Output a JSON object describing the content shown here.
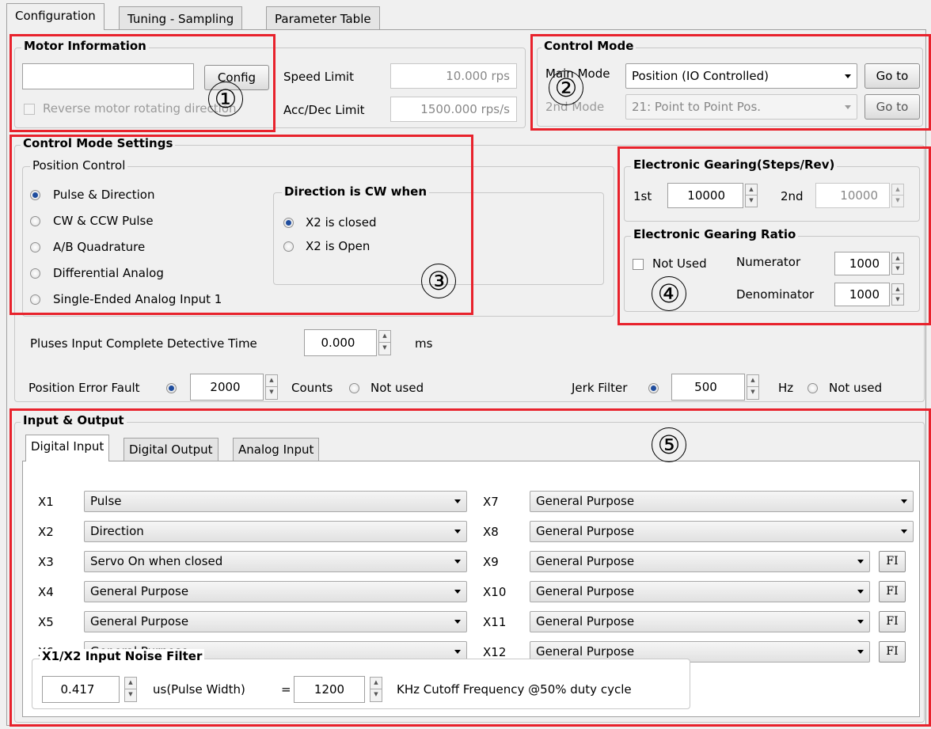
{
  "tabs": [
    "Configuration",
    "Tuning - Sampling",
    "Parameter Table"
  ],
  "annotations": [
    "①",
    "②",
    "③",
    "④",
    "⑤"
  ],
  "motor": {
    "title": "Motor Information",
    "name_value": "",
    "config_label": "Config",
    "reverse_label": "Reverse motor rotating direction",
    "speed_limit_label": "Speed Limit",
    "speed_limit_value": "10.000 rps",
    "accdec_label": "Acc/Dec Limit",
    "accdec_value": "1500.000 rps/s"
  },
  "control_mode": {
    "title": "Control Mode",
    "main_label": "Main Mode",
    "main_value": "Position (IO Controlled)",
    "second_label": "2nd Mode",
    "second_value": "21: Point to Point Pos.",
    "goto_label": "Go to"
  },
  "settings": {
    "title": "Control Mode Settings",
    "position_title": "Position Control",
    "options": [
      "Pulse & Direction",
      "CW & CCW Pulse",
      "A/B Quadrature",
      "Differential Analog",
      "Single-Ended Analog Input 1"
    ],
    "selected_index": 0,
    "direction_title": "Direction is CW when",
    "direction_options": [
      "X2 is closed",
      "X2 is Open"
    ],
    "direction_selected": 0
  },
  "gearing": {
    "steps_title": "Electronic Gearing(Steps/Rev)",
    "first_label": "1st",
    "first_value": "10000",
    "second_label": "2nd",
    "second_value": "10000",
    "ratio_title": "Electronic Gearing Ratio",
    "not_used_label": "Not Used",
    "numerator_label": "Numerator",
    "numerator_value": "1000",
    "denominator_label": "Denominator",
    "denominator_value": "1000"
  },
  "misc": {
    "pulses_label": "Pluses Input Complete Detective Time",
    "pulses_value": "0.000",
    "pulses_unit": "ms",
    "pef_label": "Position Error Fault",
    "pef_value": "2000",
    "pef_unit": "Counts",
    "not_used_label": "Not used",
    "jerk_label": "Jerk Filter",
    "jerk_value": "500",
    "jerk_unit": "Hz"
  },
  "io": {
    "title": "Input & Output",
    "subtabs": [
      "Digital Input",
      "Digital Output",
      "Analog Input"
    ],
    "left": [
      {
        "label": "X1",
        "value": "Pulse"
      },
      {
        "label": "X2",
        "value": "Direction"
      },
      {
        "label": "X3",
        "value": "Servo On when closed"
      },
      {
        "label": "X4",
        "value": "General Purpose"
      },
      {
        "label": "X5",
        "value": "General Purpose"
      },
      {
        "label": "X6",
        "value": "General Purpose"
      }
    ],
    "right": [
      {
        "label": "X7",
        "value": "General Purpose"
      },
      {
        "label": "X8",
        "value": "General Purpose"
      },
      {
        "label": "X9",
        "value": "General Purpose"
      },
      {
        "label": "X10",
        "value": "General Purpose"
      },
      {
        "label": "X11",
        "value": "General Purpose"
      },
      {
        "label": "X12",
        "value": "General Purpose"
      }
    ],
    "fi_label": "FI",
    "noise_title": "X1/X2 Input Noise Filter",
    "noise_width_value": "0.417",
    "noise_width_unit": "us(Pulse Width)",
    "equals": "=",
    "noise_freq_value": "1200",
    "noise_freq_unit": "KHz Cutoff Frequency @50% duty cycle"
  }
}
